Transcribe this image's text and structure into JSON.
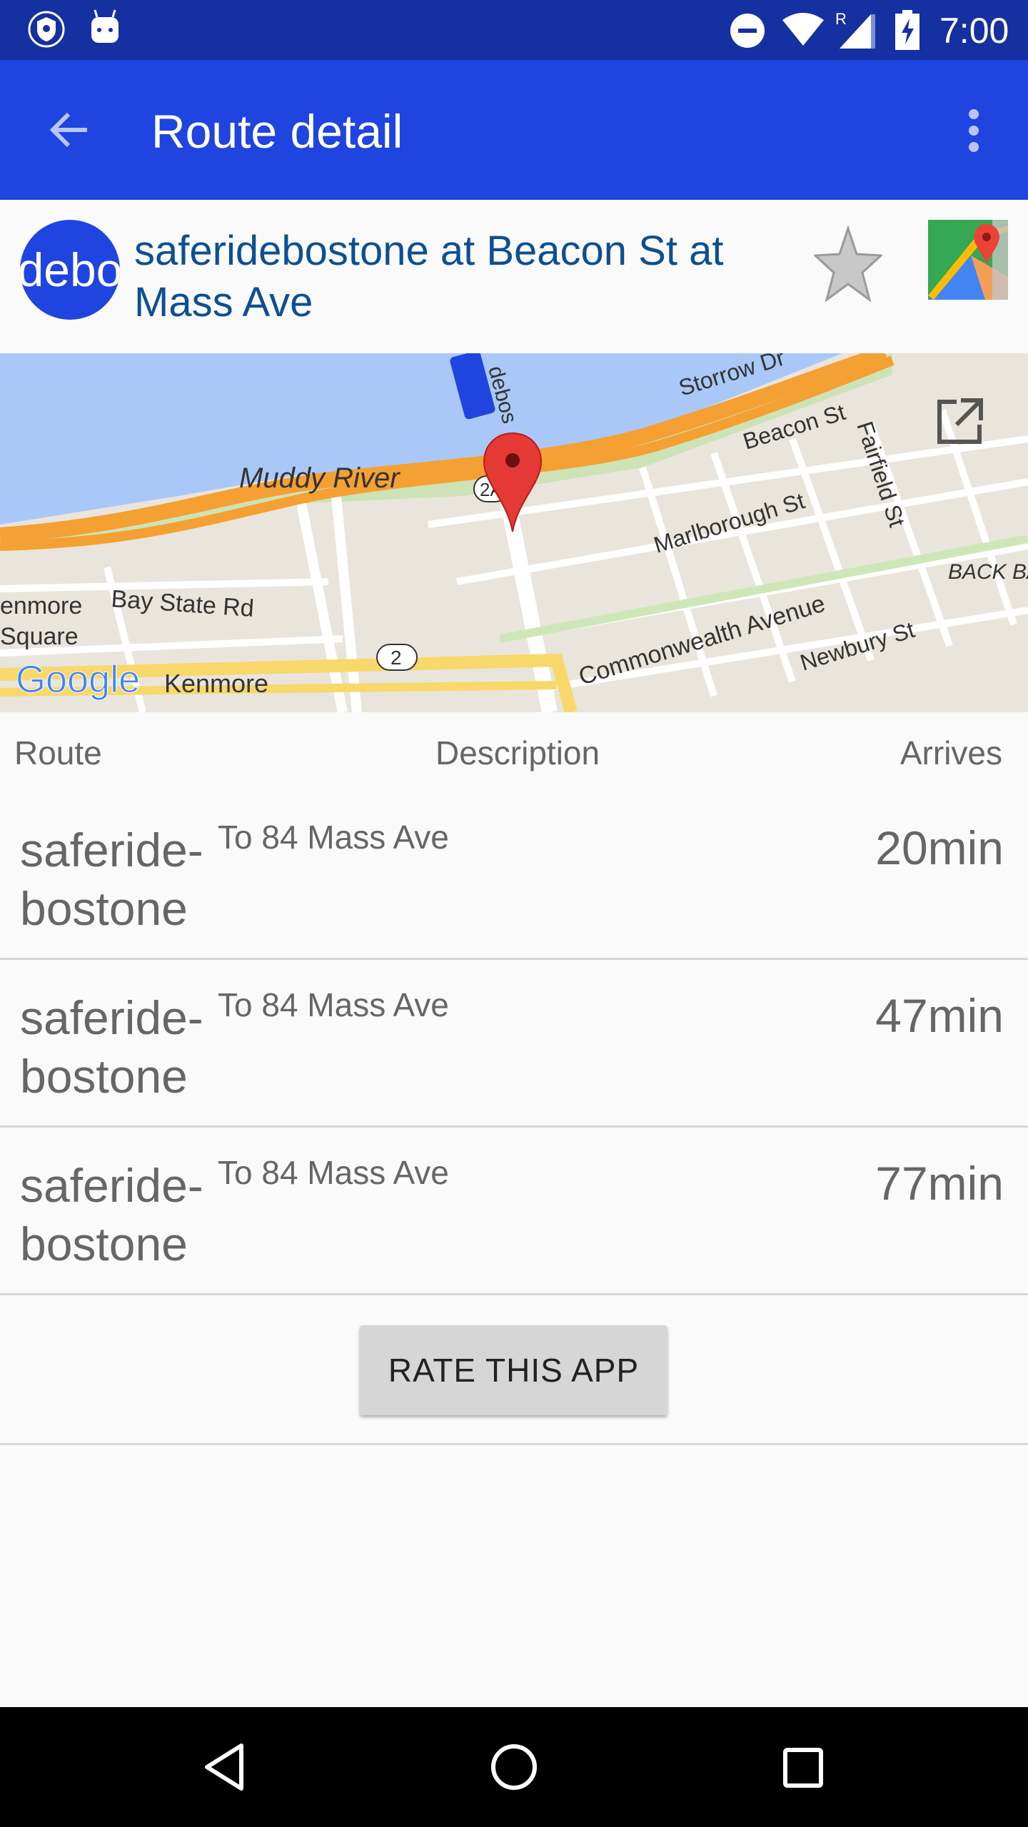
{
  "status_bar": {
    "time": "7:00",
    "icons": [
      "vpn-shield-icon",
      "android-icon",
      "do-not-disturb-icon",
      "wifi-icon",
      "signal-roaming-icon",
      "battery-charging-icon"
    ],
    "roaming": "R"
  },
  "app_bar": {
    "title": "Route detail",
    "back_icon": "arrow-back-icon",
    "menu_icon": "more-vert-icon",
    "color": "#1f44e0"
  },
  "stop": {
    "avatar_text": "debo",
    "name": "saferidebostone at Beacon St at Mass Ave",
    "favorite_icon": "star-icon",
    "maps_icon": "google-maps-icon",
    "name_color": "#0d4f92"
  },
  "map": {
    "labels": {
      "storrow": "Storrow Dr",
      "beacon": "Beacon St",
      "fairfield": "Fairfield St",
      "muddy": "Muddy River",
      "marlborough": "Marlborough St",
      "backbay": "BACK BA",
      "kenmore_sq1": "enmore",
      "kenmore_sq2": "Square",
      "bay_state": "Bay State Rd",
      "commonwealth": "Commonwealth Avenue",
      "newbury": "Newbury St",
      "kenmore": "Kenmore",
      "route2": "2",
      "route2a": "2A",
      "bus": "debos"
    },
    "logo": "Google",
    "open_icon": "open-external-icon"
  },
  "columns": {
    "route": "Route",
    "description": "Description",
    "arrives": "Arrives"
  },
  "arrivals": [
    {
      "route": "saferide-bostone",
      "description": "To 84 Mass Ave",
      "arrives": "20min"
    },
    {
      "route": "saferide-bostone",
      "description": "To 84 Mass Ave",
      "arrives": "47min"
    },
    {
      "route": "saferide-bostone",
      "description": "To 84 Mass Ave",
      "arrives": "77min"
    }
  ],
  "rate_button": "RATE THIS APP",
  "nav_bar": {
    "icons": [
      "back-triangle-icon",
      "home-circle-icon",
      "recents-square-icon"
    ]
  }
}
